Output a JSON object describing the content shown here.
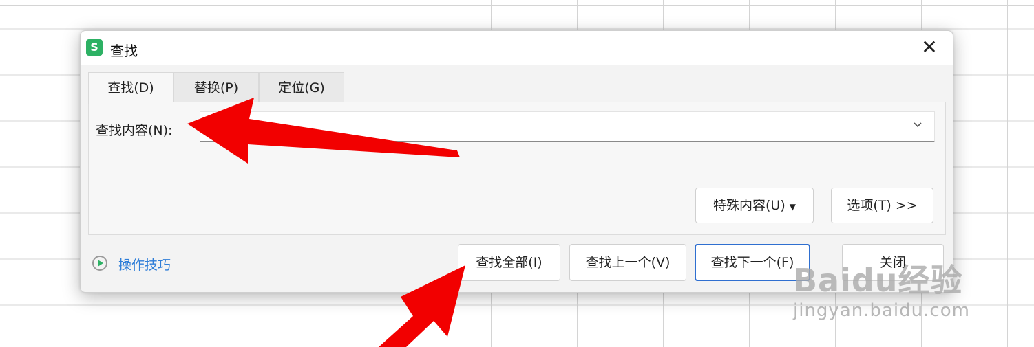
{
  "dialog": {
    "title": "查找",
    "app_icon": "S",
    "close_icon": "✕",
    "tabs": [
      {
        "label": "查找(D)"
      },
      {
        "label": "替换(P)"
      },
      {
        "label": "定位(G)"
      }
    ],
    "find_label": "查找内容(N):",
    "find_value": "",
    "dropdown_icon": "chevron-down-icon",
    "special_button": "特殊内容(U)",
    "options_button": "选项(T) >>",
    "tips_link": "操作技巧",
    "find_all_button": "查找全部(I)",
    "find_prev_button": "查找上一个(V)",
    "find_next_button": "查找下一个(F)",
    "close_button": "关闭"
  },
  "watermark": {
    "logo": "Baidu经验",
    "url": "jingyan.baidu.com"
  },
  "colors": {
    "accent": "#2f6fd0",
    "app_icon_bg": "#2db164",
    "link": "#2f7ed8",
    "annotation_arrow": "#ff0000"
  }
}
